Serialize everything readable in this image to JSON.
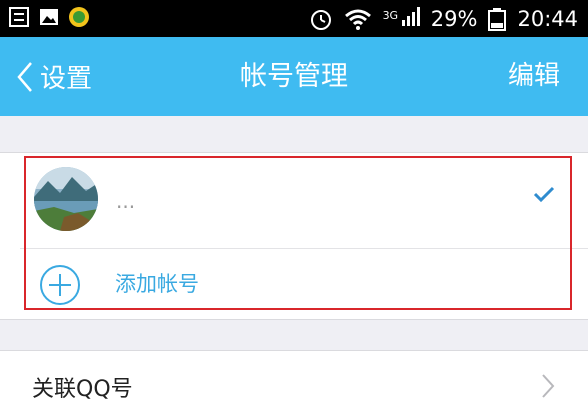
{
  "status_bar": {
    "network": "3G",
    "battery": "29%",
    "time": "20:44"
  },
  "nav": {
    "back_label": "设置",
    "title": "帐号管理",
    "edit_label": "编辑"
  },
  "account": {
    "name": "...",
    "selected": true
  },
  "add_account": {
    "label": "添加帐号"
  },
  "linked_qq": {
    "label": "关联QQ号"
  },
  "colors": {
    "nav_bg": "#3fbbf1",
    "accent_text": "#3aa9e1",
    "check": "#2f8ccf",
    "highlight_border": "#d9262b"
  },
  "icons": [
    "list-icon",
    "image-icon",
    "app-badge-icon",
    "alarm-icon",
    "wifi-icon",
    "signal-icon",
    "battery-icon",
    "back-chevron-icon",
    "checkmark-icon",
    "add-circle-icon",
    "chevron-right-icon"
  ]
}
